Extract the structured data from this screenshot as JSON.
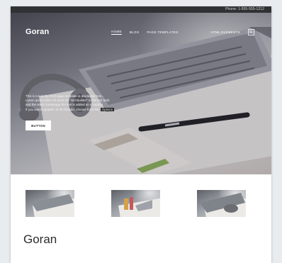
{
  "topbar": {
    "phone": "Phone: 1-555-555-1212"
  },
  "brand": {
    "name": "Goran"
  },
  "nav": {
    "items": [
      {
        "label": "Home",
        "active": true
      },
      {
        "label": "Blog",
        "active": false
      },
      {
        "label": "Page Templates",
        "active": false
      },
      {
        "label": "HTML Elements",
        "active": false
      }
    ],
    "search_icon": "search-icon"
  },
  "hero": {
    "lead_line1": "This is a text the front page template is displayed here...",
    "lead_line2": "Lorem ipsum dolor sit amet vel \"Set Builder\" in the text field.",
    "lead_line3": "and the static homepage the text is added as a caption",
    "lead_line4": "If you want a graphic in the header, choose from the",
    "tag": "Options",
    "button": "Button"
  },
  "footer_title": "Goran",
  "colors": {
    "topbar": "#2f3133",
    "page_background": "#e9ecef",
    "button_background": "#ffffff",
    "title_text": "#2b2b2b"
  }
}
